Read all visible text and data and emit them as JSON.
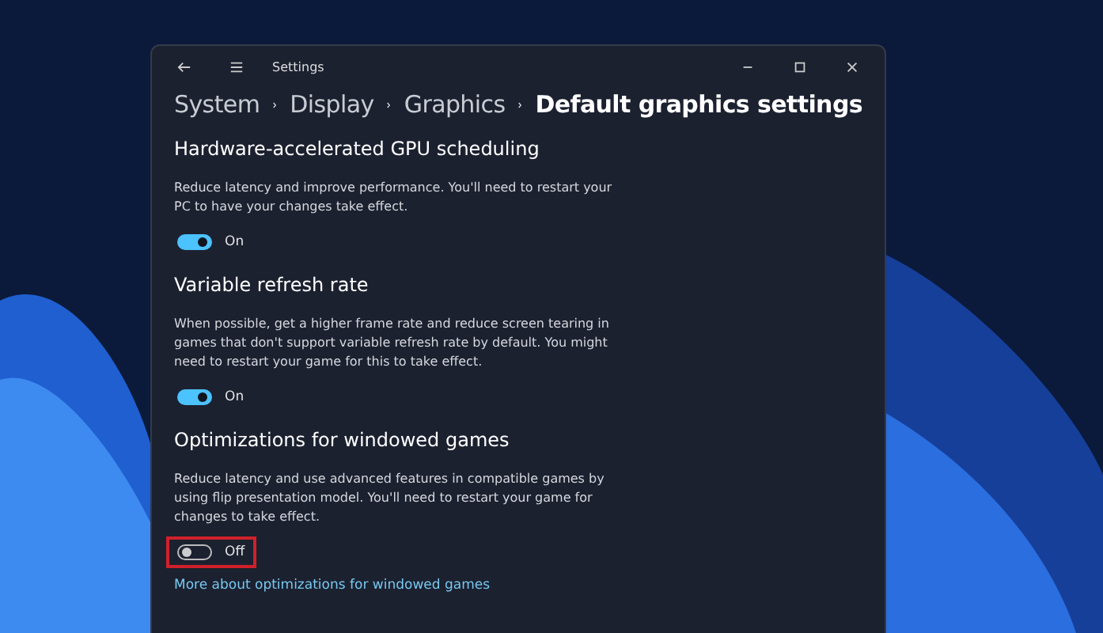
{
  "window": {
    "title": "Settings"
  },
  "breadcrumb": [
    {
      "label": "System",
      "current": false
    },
    {
      "label": "Display",
      "current": false
    },
    {
      "label": "Graphics",
      "current": false
    },
    {
      "label": "Default graphics settings",
      "current": true
    }
  ],
  "settings": [
    {
      "title": "Hardware-accelerated GPU scheduling",
      "description": "Reduce latency and improve performance. You'll need to restart your PC to have your changes take effect.",
      "on": true,
      "state_label": "On",
      "highlighted": false
    },
    {
      "title": "Variable refresh rate",
      "description": "When possible, get a higher frame rate and reduce screen tearing in games that don't support variable refresh rate by default. You might need to restart your game for this to take effect.",
      "on": true,
      "state_label": "On",
      "highlighted": false
    },
    {
      "title": "Optimizations for windowed games",
      "description": "Reduce latency and use advanced features in compatible games by using flip presentation model. You'll need to restart your game for changes to take effect.",
      "on": false,
      "state_label": "Off",
      "highlighted": true,
      "link": "More about optimizations for windowed games"
    }
  ]
}
